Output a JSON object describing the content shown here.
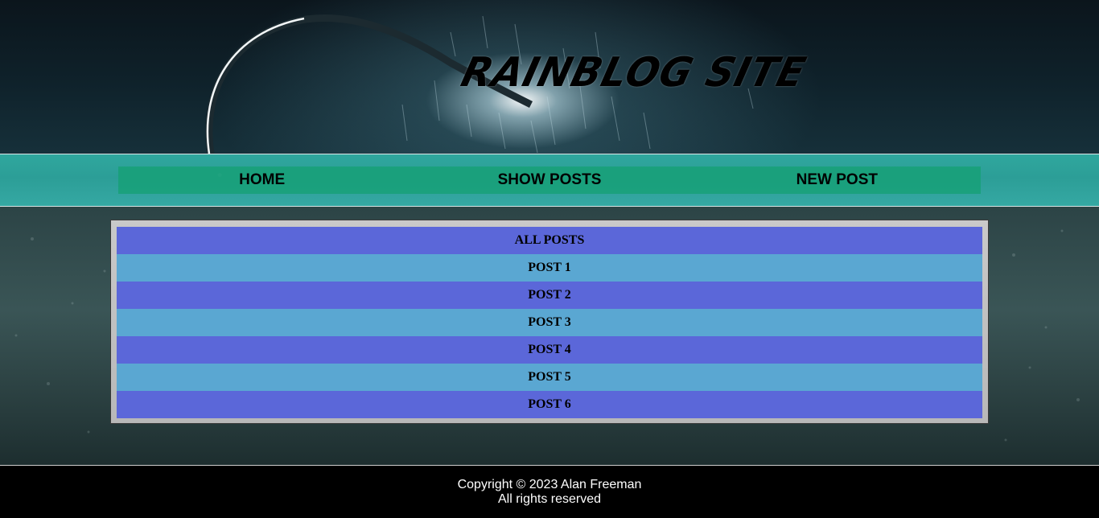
{
  "header": {
    "site_title": "RAINBLOG SITE"
  },
  "nav": {
    "items": [
      {
        "label": "HOME"
      },
      {
        "label": "SHOW POSTS"
      },
      {
        "label": "NEW POST"
      }
    ]
  },
  "posts_table": {
    "header": "ALL POSTS",
    "rows": [
      "POST 1",
      "POST 2",
      "POST 3",
      "POST 4",
      "POST 5",
      "POST 6"
    ]
  },
  "footer": {
    "copyright": "Copyright © 2023 Alan Freeman",
    "rights": "All rights reserved"
  },
  "colors": {
    "nav_band": "#2fa79e",
    "nav_bar": "#14a073",
    "row_blue": "#5b67d9",
    "row_light": "#5aa7d2",
    "panel_border": "#c0c0c0",
    "footer_bg": "#000000"
  }
}
